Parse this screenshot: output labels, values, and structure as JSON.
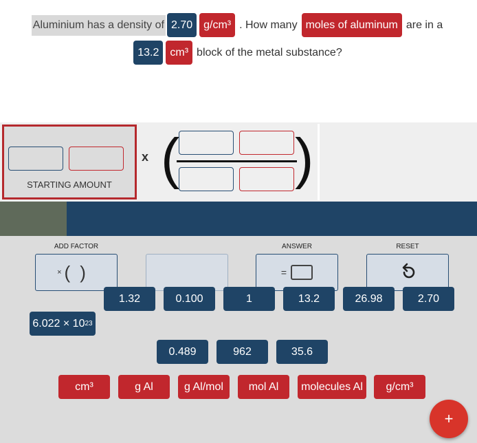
{
  "question": {
    "line1": {
      "text1": "Aluminium has a density of",
      "value": "2.70",
      "unit": "g/cm³",
      "text2": ". How many",
      "target": "moles of aluminum",
      "text3": "are in a"
    },
    "line2": {
      "value": "13.2",
      "unit": "cm³",
      "text": "block of the metal substance?"
    }
  },
  "workspace": {
    "starting_amount_label": "STARTING AMOUNT",
    "multiply_symbol": "x",
    "open_paren": "(",
    "close_paren": ")"
  },
  "progress": {
    "fraction": 0.14
  },
  "controls": {
    "add_factor_label": "ADD FACTOR",
    "add_factor_symbol": "×",
    "answer_label": "ANSWER",
    "answer_symbol": "=",
    "reset_label": "RESET"
  },
  "numbers": [
    {
      "base": "6.022 × 10",
      "exp": "23"
    },
    {
      "base": "1.32",
      "exp": ""
    },
    {
      "base": "0.100",
      "exp": ""
    },
    {
      "base": "1",
      "exp": ""
    },
    {
      "base": "13.2",
      "exp": ""
    },
    {
      "base": "26.98",
      "exp": ""
    },
    {
      "base": "2.70",
      "exp": ""
    },
    {
      "base": "0.489",
      "exp": ""
    },
    {
      "base": "962",
      "exp": ""
    },
    {
      "base": "35.6",
      "exp": ""
    }
  ],
  "units": [
    "cm³",
    "g Al",
    "g Al/mol",
    "mol Al",
    "molecules Al",
    "g/cm³"
  ],
  "fab": {
    "symbol": "+"
  },
  "colors": {
    "navy": "#1f4466",
    "red": "#c1272d",
    "fab": "#d8342a"
  }
}
